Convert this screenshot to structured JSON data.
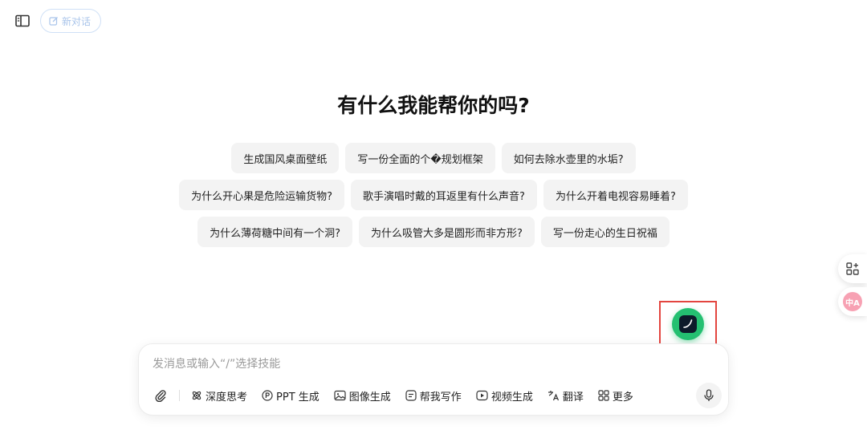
{
  "topbar": {
    "sidebar_toggle_icon": "sidebar-panel-icon",
    "new_chat_label": "新对话",
    "new_chat_icon": "edit-icon"
  },
  "headline": "有什么我能帮你的吗?",
  "suggestions": [
    [
      "生成国风桌面壁纸",
      "写一份全面的个�规划框架",
      "如何去除水壶里的水垢?"
    ],
    [
      "为什么开心果是危险运输货物?",
      "歌手演唱时戴的耳返里有什么声音?",
      "为什么开着电视容易睡着?"
    ],
    [
      "为什么薄荷糖中间有一个洞?",
      "为什么吸管大多是圆形而非方形?",
      "写一份走心的生日祝福"
    ]
  ],
  "composer": {
    "placeholder": "发消息或输入“/”选择技能",
    "value": "",
    "tools": [
      {
        "label": "深度思考",
        "icon": "atom-icon"
      },
      {
        "label": "PPT 生成",
        "icon": "ppt-icon"
      },
      {
        "label": "图像生成",
        "icon": "image-icon"
      },
      {
        "label": "帮我写作",
        "icon": "writing-icon"
      },
      {
        "label": "视频生成",
        "icon": "video-icon"
      },
      {
        "label": "翻译",
        "icon": "translate-icon"
      },
      {
        "label": "更多",
        "icon": "grid-icon"
      }
    ],
    "attach_icon": "paperclip-icon",
    "mic_icon": "microphone-icon"
  },
  "side_tools": {
    "apps_icon": "apps-grid-plus-icon",
    "translate_badge": "中A"
  },
  "colors": {
    "fab": "#24c071",
    "highlight": "#e3453f",
    "new_chat_border": "#cfe0f6",
    "chip_bg": "#f3f3f3"
  }
}
